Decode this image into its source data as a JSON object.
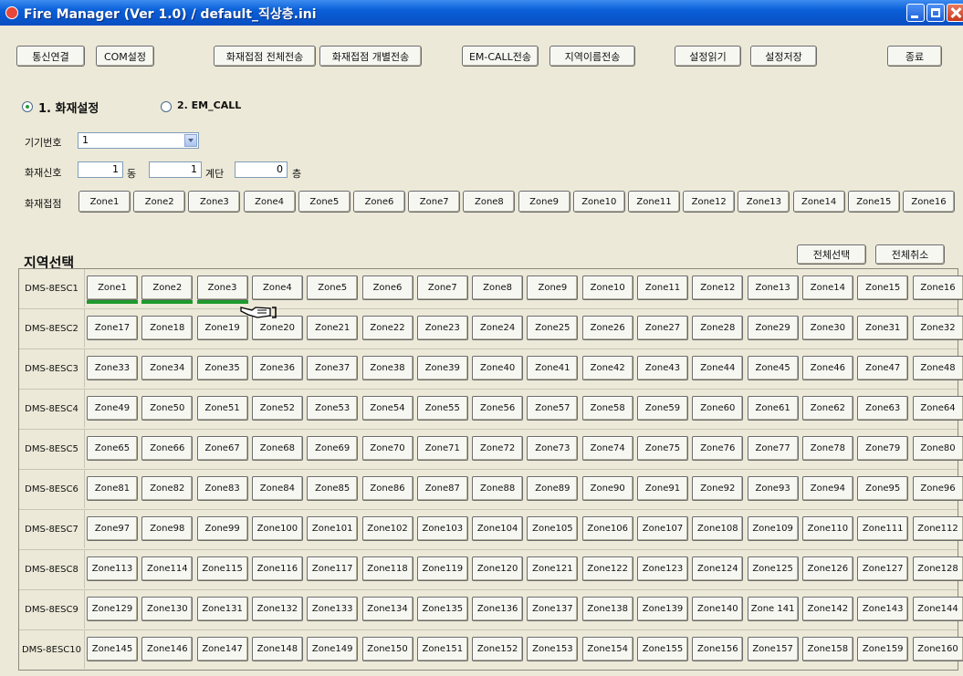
{
  "window": {
    "title": "Fire Manager (Ver 1.0) / default_직상층.ini"
  },
  "toolbar": {
    "connect": "통신연결",
    "com_settings": "COM설정",
    "send_all": "화재접점 전체전송",
    "send_each": "화재접점 개별전송",
    "emcall_send": "EM-CALL전송",
    "area_name_send": "지역이름전송",
    "load_settings": "설정읽기",
    "save_settings": "설정저장",
    "exit": "종료"
  },
  "mode": {
    "option1": "1. 화재설정",
    "option2": "2. EM_CALL",
    "selected": "1. 화재설정"
  },
  "device": {
    "label": "기기번호",
    "value": "1"
  },
  "signal": {
    "label": "화재신호",
    "dong_value": "1",
    "dong_unit": "동",
    "stair_value": "1",
    "stair_unit": "계단",
    "floor_value": "0",
    "floor_unit": "층"
  },
  "contacts": {
    "label": "화재접점",
    "zones": [
      "Zone1",
      "Zone2",
      "Zone3",
      "Zone4",
      "Zone5",
      "Zone6",
      "Zone7",
      "Zone8",
      "Zone9",
      "Zone10",
      "Zone11",
      "Zone12",
      "Zone13",
      "Zone14",
      "Zone15",
      "Zone16"
    ]
  },
  "area_select": {
    "title": "지역선택",
    "select_all": "전체선택",
    "cancel_all": "전체취소",
    "active_zones": [
      "Zone1",
      "Zone2",
      "Zone3"
    ],
    "rows": [
      {
        "label": "DMS-8ESC1",
        "zones": [
          "Zone1",
          "Zone2",
          "Zone3",
          "Zone4",
          "Zone5",
          "Zone6",
          "Zone7",
          "Zone8",
          "Zone9",
          "Zone10",
          "Zone11",
          "Zone12",
          "Zone13",
          "Zone14",
          "Zone15",
          "Zone16"
        ]
      },
      {
        "label": "DMS-8ESC2",
        "zones": [
          "Zone17",
          "Zone18",
          "Zone19",
          "Zone20",
          "Zone21",
          "Zone22",
          "Zone23",
          "Zone24",
          "Zone25",
          "Zone26",
          "Zone27",
          "Zone28",
          "Zone29",
          "Zone30",
          "Zone31",
          "Zone32"
        ]
      },
      {
        "label": "DMS-8ESC3",
        "zones": [
          "Zone33",
          "Zone34",
          "Zone35",
          "Zone36",
          "Zone37",
          "Zone38",
          "Zone39",
          "Zone40",
          "Zone41",
          "Zone42",
          "Zone43",
          "Zone44",
          "Zone45",
          "Zone46",
          "Zone47",
          "Zone48"
        ]
      },
      {
        "label": "DMS-8ESC4",
        "zones": [
          "Zone49",
          "Zone50",
          "Zone51",
          "Zone52",
          "Zone53",
          "Zone54",
          "Zone55",
          "Zone56",
          "Zone57",
          "Zone58",
          "Zone59",
          "Zone60",
          "Zone61",
          "Zone62",
          "Zone63",
          "Zone64"
        ]
      },
      {
        "label": "DMS-8ESC5",
        "zones": [
          "Zone65",
          "Zone66",
          "Zone67",
          "Zone68",
          "Zone69",
          "Zone70",
          "Zone71",
          "Zone72",
          "Zone73",
          "Zone74",
          "Zone75",
          "Zone76",
          "Zone77",
          "Zone78",
          "Zone79",
          "Zone80"
        ]
      },
      {
        "label": "DMS-8ESC6",
        "zones": [
          "Zone81",
          "Zone82",
          "Zone83",
          "Zone84",
          "Zone85",
          "Zone86",
          "Zone87",
          "Zone88",
          "Zone89",
          "Zone90",
          "Zone91",
          "Zone92",
          "Zone93",
          "Zone94",
          "Zone95",
          "Zone96"
        ]
      },
      {
        "label": "DMS-8ESC7",
        "zones": [
          "Zone97",
          "Zone98",
          "Zone99",
          "Zone100",
          "Zone101",
          "Zone102",
          "Zone103",
          "Zone104",
          "Zone105",
          "Zone106",
          "Zone107",
          "Zone108",
          "Zone109",
          "Zone110",
          "Zone111",
          "Zone112"
        ]
      },
      {
        "label": "DMS-8ESC8",
        "zones": [
          "Zone113",
          "Zone114",
          "Zone115",
          "Zone116",
          "Zone117",
          "Zone118",
          "Zone119",
          "Zone120",
          "Zone121",
          "Zone122",
          "Zone123",
          "Zone124",
          "Zone125",
          "Zone126",
          "Zone127",
          "Zone128"
        ]
      },
      {
        "label": "DMS-8ESC9",
        "zones": [
          "Zone129",
          "Zone130",
          "Zone131",
          "Zone132",
          "Zone133",
          "Zone134",
          "Zone135",
          "Zone136",
          "Zone137",
          "Zone138",
          "Zone139",
          "Zone140",
          "Zone 141",
          "Zone142",
          "Zone143",
          "Zone144"
        ]
      },
      {
        "label": "DMS-8ESC10",
        "zones": [
          "Zone145",
          "Zone146",
          "Zone147",
          "Zone148",
          "Zone149",
          "Zone150",
          "Zone151",
          "Zone152",
          "Zone153",
          "Zone154",
          "Zone155",
          "Zone156",
          "Zone157",
          "Zone158",
          "Zone159",
          "Zone160"
        ]
      }
    ]
  },
  "colors": {
    "titlebar": "#0a5fd8",
    "active_indicator": "#1f9a2e",
    "window_bg": "#ece9d8"
  }
}
